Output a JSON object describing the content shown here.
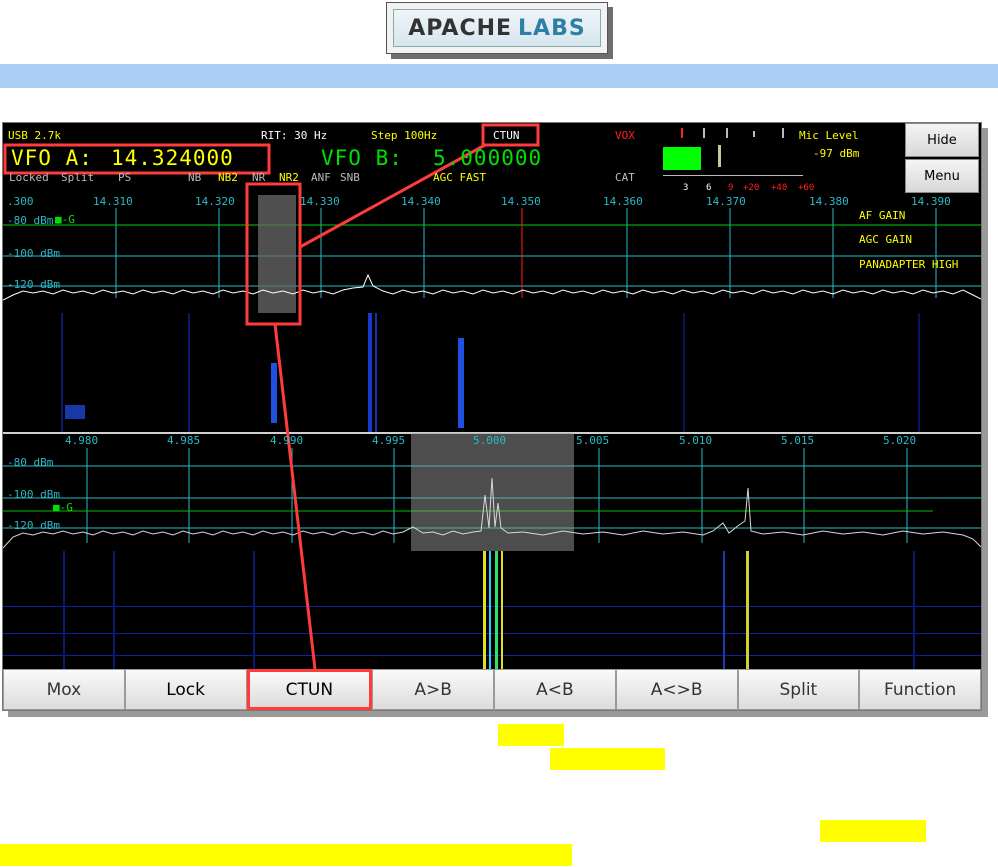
{
  "logo": {
    "word1": "APACHE",
    "word2": "LABS"
  },
  "status": {
    "mode": "USB 2.7k",
    "rit": "RIT: 30 Hz",
    "step": "Step 100Hz",
    "ctun": "CTUN",
    "vox": "VOX",
    "mic_level_label": "Mic Level",
    "mic_level_value": "-97 dBm",
    "locked": "Locked",
    "split": "Split",
    "ps": "PS",
    "nb": "NB",
    "nb2": "NB2",
    "nr": "NR",
    "nr2": "NR2",
    "anf": "ANF",
    "snb": "SNB",
    "agc": "AGC FAST",
    "cat": "CAT",
    "meter_scale": [
      "3",
      "6",
      "9",
      "+20",
      "+40",
      "+60"
    ]
  },
  "vfo_a": {
    "label": "VFO A:",
    "freq": "14.324000"
  },
  "vfo_b": {
    "label": "VFO B:",
    "freq": "5.000000"
  },
  "side_buttons": {
    "hide": "Hide",
    "menu": "Menu"
  },
  "pan_a": {
    "freq_labels": [
      ".300",
      "14.310",
      "14.320",
      "14.330",
      "14.340",
      "14.350",
      "14.360",
      "14.370",
      "14.380",
      "14.390"
    ],
    "db_labels": [
      "-80 dBm",
      "-100 dBm",
      "-120 dBm"
    ],
    "gain_marker": "G",
    "right_labels": [
      "AF GAIN",
      "AGC GAIN",
      "PANADAPTER HIGH"
    ]
  },
  "pan_b": {
    "freq_labels": [
      "4.980",
      "4.985",
      "4.990",
      "4.995",
      "5.000",
      "5.005",
      "5.010",
      "5.015",
      "5.020"
    ],
    "db_labels": [
      "-80 dBm",
      "-100 dBm",
      "-120 dBm"
    ],
    "gain_marker": "G"
  },
  "bottom_buttons": [
    "Mox",
    "Lock",
    "CTUN",
    "A>B",
    "A<B",
    "A<>B",
    "Split",
    "Function"
  ],
  "colors": {
    "highlight": "#ff3b3b",
    "grid": "#2bb9c6",
    "spectrum": "#ffffff",
    "banner": "#a9cdf4"
  }
}
